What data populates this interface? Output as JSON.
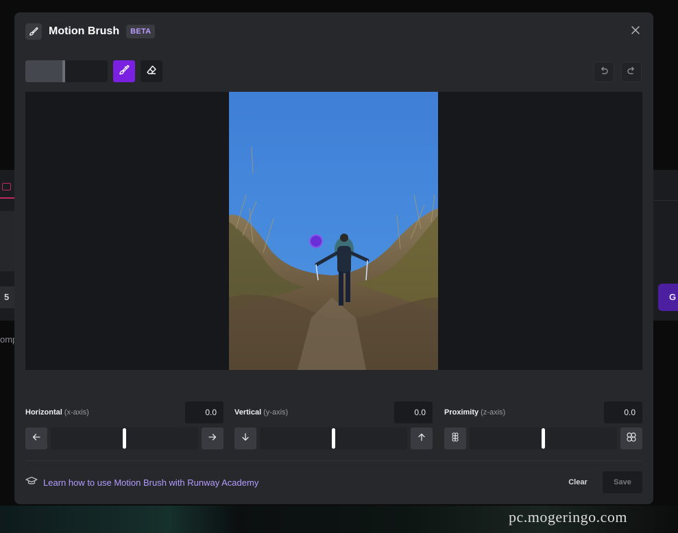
{
  "background_app": {
    "counter_value": "5",
    "generate_partial": "G",
    "comp_partial": "omp"
  },
  "modal": {
    "title": "Motion Brush",
    "badge": "BETA",
    "close_icon": "close-icon",
    "accent_color": "#7a20e0"
  },
  "toolbar": {
    "brush_size_fraction": 0.45,
    "brush_tool_icon": "paintbrush-icon",
    "eraser_tool_icon": "eraser-icon",
    "undo_icon": "undo-icon",
    "redo_icon": "redo-icon"
  },
  "axes": {
    "horizontal": {
      "label": "Horizontal",
      "sub": "(x-axis)",
      "value": "0.0",
      "level": 0.5
    },
    "vertical": {
      "label": "Vertical",
      "sub": "(y-axis)",
      "value": "0.0",
      "level": 0.5
    },
    "proximity": {
      "label": "Proximity",
      "sub": "(z-axis)",
      "value": "0.0",
      "level": 0.5
    }
  },
  "footer": {
    "academy_link": "Learn how to use Motion Brush with Runway Academy",
    "clear_label": "Clear",
    "save_label": "Save"
  },
  "watermark": "pc.mogeringo.com"
}
